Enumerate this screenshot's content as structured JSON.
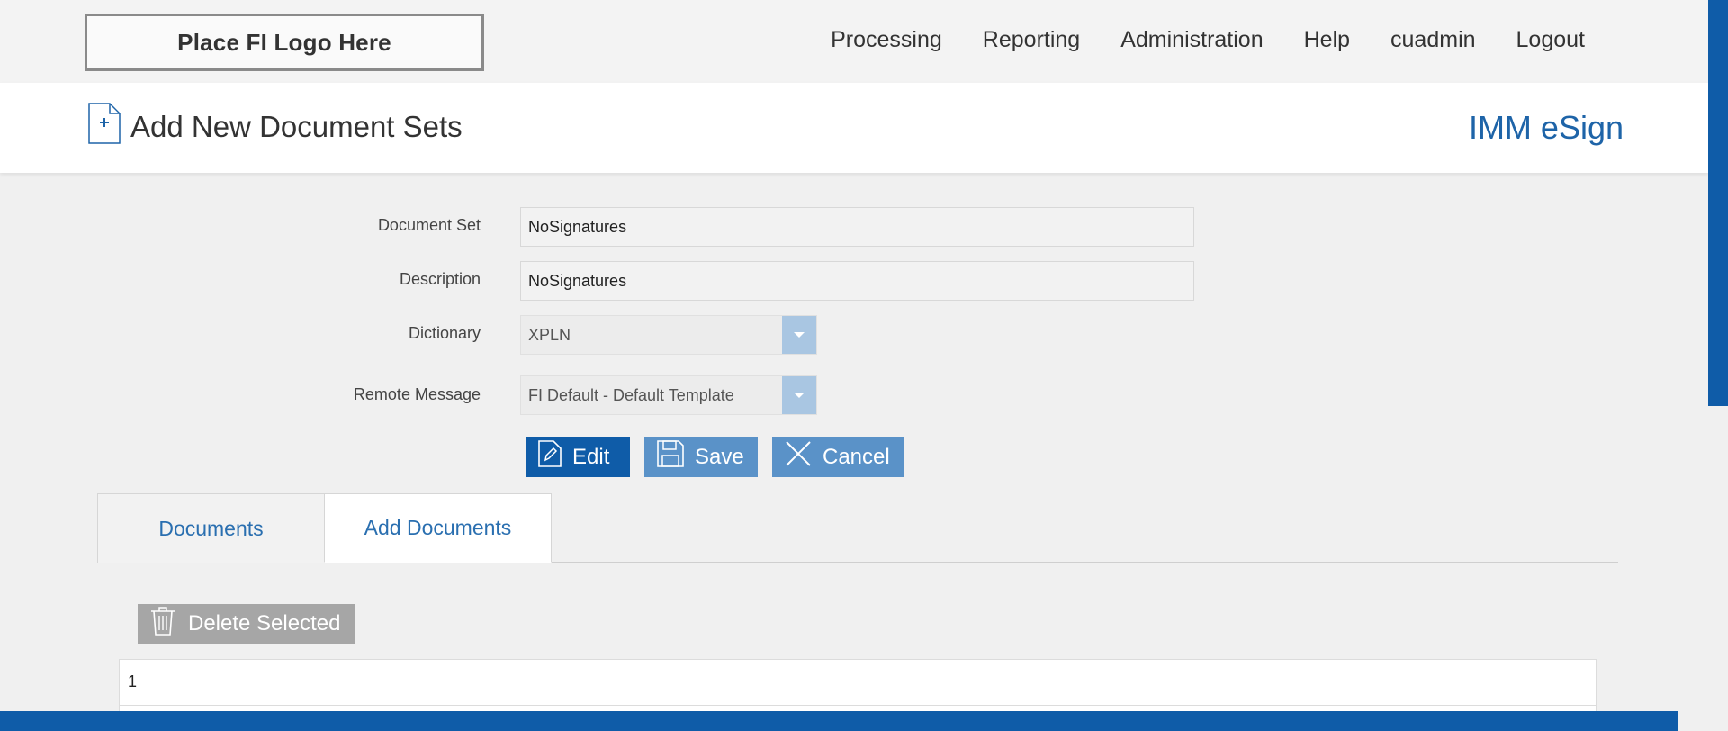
{
  "logo": {
    "text": "Place FI Logo Here"
  },
  "nav": {
    "items": [
      "Processing",
      "Reporting",
      "Administration",
      "Help",
      "cuadmin",
      "Logout"
    ]
  },
  "header": {
    "title": "Add New Document Sets",
    "brand": "IMM eSign"
  },
  "form": {
    "document_set": {
      "label": "Document Set",
      "value": "NoSignatures"
    },
    "description": {
      "label": "Description",
      "value": "NoSignatures"
    },
    "dictionary": {
      "label": "Dictionary",
      "value": "XPLN"
    },
    "remote_message": {
      "label": "Remote Message",
      "value": "FI Default - Default Template"
    }
  },
  "actions": {
    "edit": "Edit",
    "save": "Save",
    "cancel": "Cancel"
  },
  "tabs": [
    {
      "label": "Documents",
      "active": false
    },
    {
      "label": "Add Documents",
      "active": true
    }
  ],
  "documents": {
    "delete_label": "Delete Selected",
    "rows": [
      {
        "value": "1"
      }
    ]
  },
  "colors": {
    "primary": "#0f5ca8",
    "secondary_button": "#5a92c8",
    "brand_text": "#1e64a8",
    "disabled_button": "#a6a6a6"
  }
}
